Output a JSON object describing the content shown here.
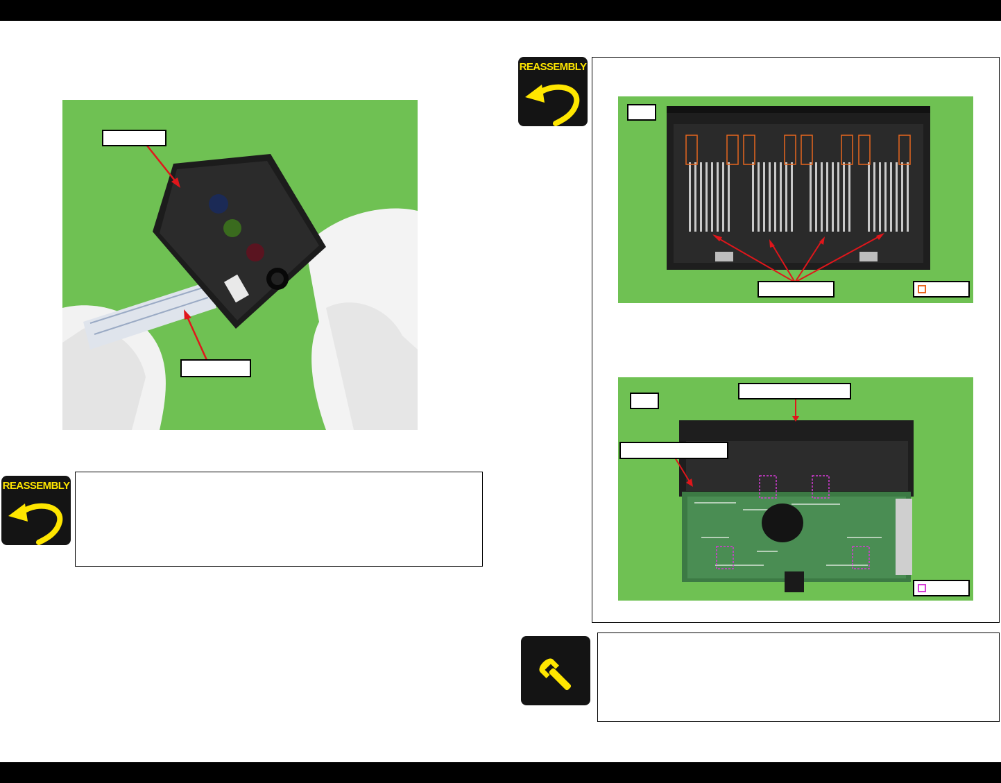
{
  "page": {
    "reassembly_label": "REASSEMBLY"
  },
  "colors": {
    "header_bar": "#000000",
    "photo_green": "#6fc153",
    "arrow_red": "#e0161b",
    "reassembly_yellow": "#ffe600",
    "legend_orange": "#e8661e",
    "legend_magenta": "#d63bd6"
  },
  "icons": {
    "reassembly": "reassembly-arrow-icon",
    "adjustment": "wrench-icon"
  },
  "photos": {
    "printhead": {
      "callout_top": "",
      "callout_bottom": ""
    },
    "holder_top": {
      "tag": "",
      "callout": "",
      "legend": ""
    },
    "holder_bottom": {
      "tag": "",
      "callout_top": "",
      "callout_left": "",
      "legend": ""
    }
  }
}
